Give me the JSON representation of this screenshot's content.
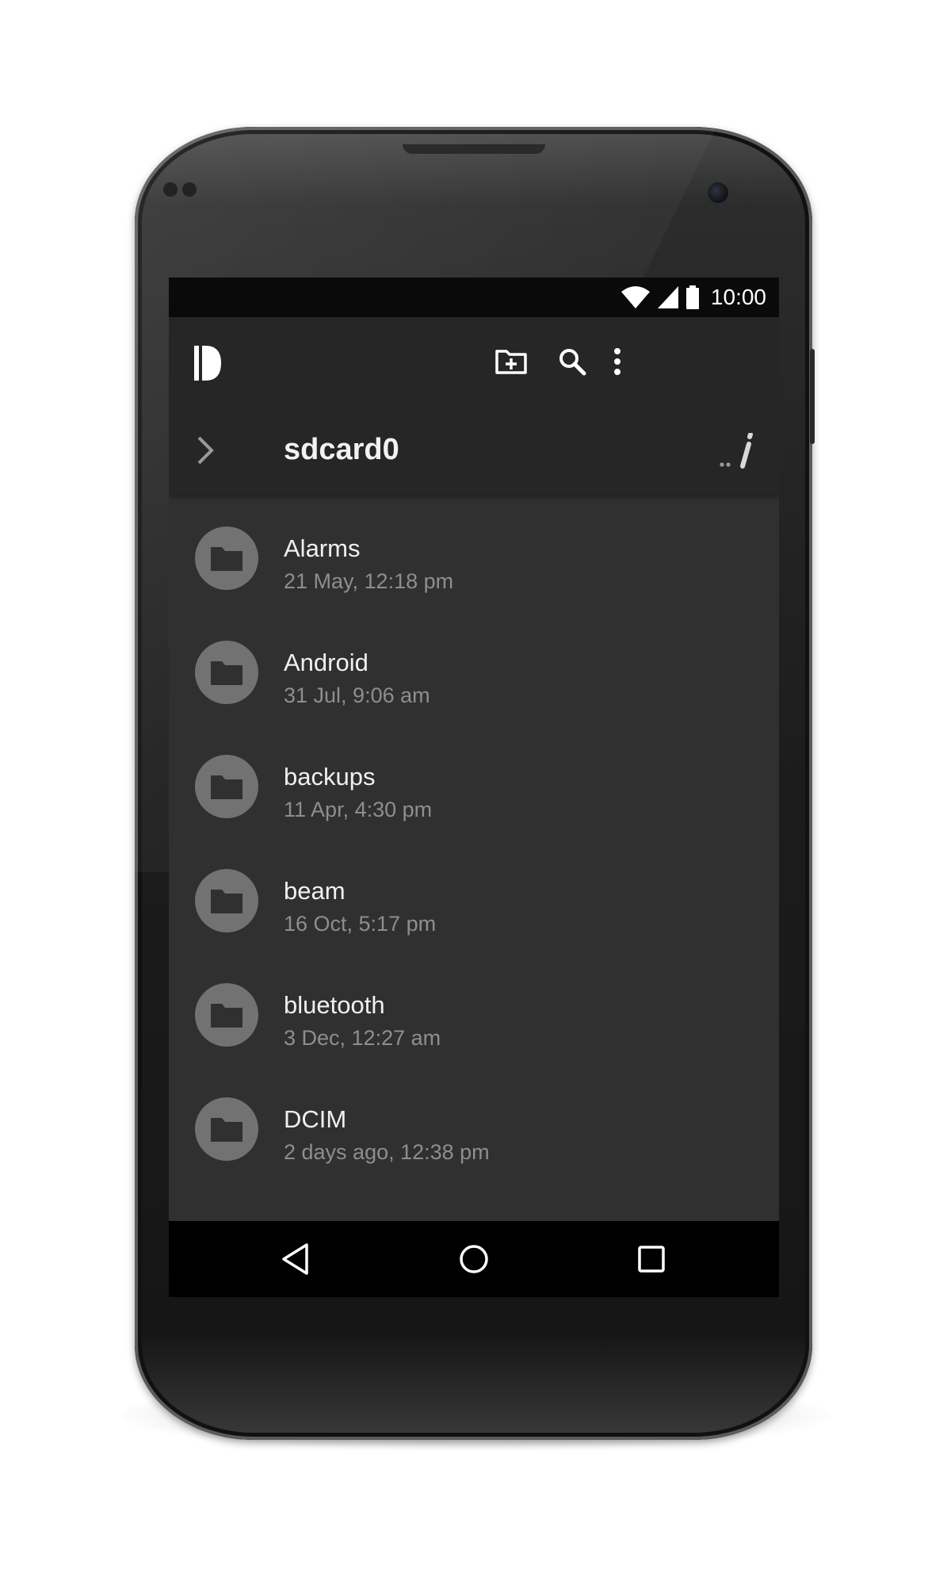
{
  "status_bar": {
    "time": "10:00"
  },
  "toolbar": {
    "new_folder_icon": "create-new-folder-icon",
    "search_icon": "search-icon",
    "overflow_icon": "more-vert-icon"
  },
  "path": {
    "current": "sdcard0",
    "edit_label": ".."
  },
  "files": [
    {
      "name": "Alarms",
      "modified": "21 May, 12:18 pm"
    },
    {
      "name": "Android",
      "modified": "31 Jul, 9:06 am"
    },
    {
      "name": "backups",
      "modified": "11 Apr, 4:30 pm"
    },
    {
      "name": "beam",
      "modified": "16 Oct, 5:17 pm"
    },
    {
      "name": "bluetooth",
      "modified": "3 Dec, 12:27 am"
    },
    {
      "name": "DCIM",
      "modified": "2 days ago, 12:38 pm"
    }
  ],
  "colors": {
    "screen_bg": "#303030",
    "toolbar_bg": "#262626",
    "folder_avatar": "#727272"
  }
}
